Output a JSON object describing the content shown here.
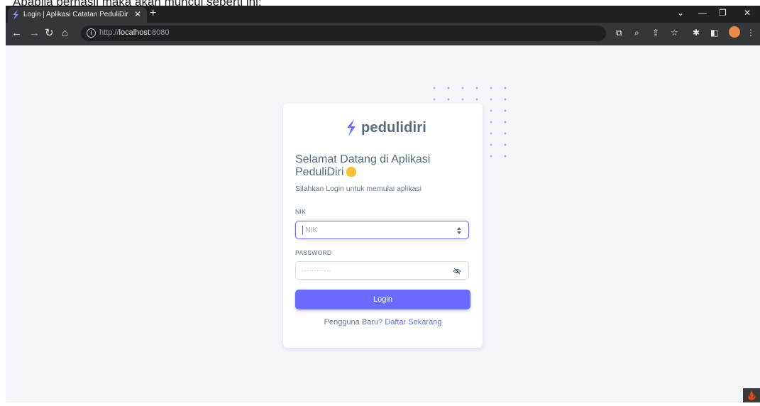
{
  "caption": "Apabila berhasil maka akan muncul seperti ini:",
  "browser": {
    "tab_title": "Login | Aplikasi Catatan PeduliDiri",
    "tab_close": "✕",
    "new_tab": "+",
    "url_scheme": "http://",
    "url_host": "localhost",
    "url_port": ":8080"
  },
  "page": {
    "brand_name": "pedulidiri",
    "welcome_title": "Selamat Datang di Aplikasi PeduliDiri",
    "subtitle": "Silahkan Login untuk memulai aplikasi",
    "nik_label": "NIK",
    "nik_placeholder": "NIK",
    "password_label": "PASSWORD",
    "password_mask": "············",
    "login_button": "Login",
    "register_prompt": "Pengguna Baru?",
    "register_link": "Daftar Sekarang"
  },
  "colors": {
    "primary": "#696cff",
    "background": "#f5f5f9",
    "heading": "#566a7f"
  }
}
